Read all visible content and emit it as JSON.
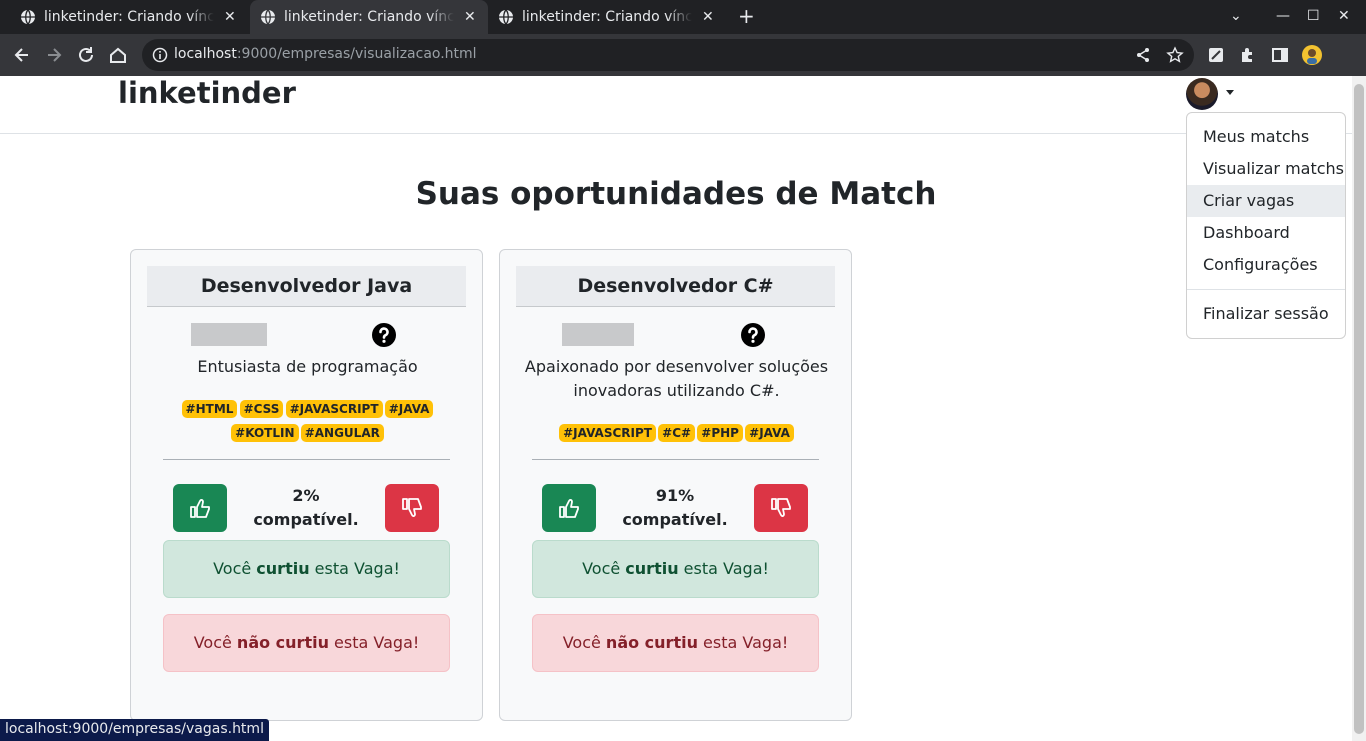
{
  "browser": {
    "tabs": [
      {
        "title": "linketinder: Criando vínculos",
        "active": false
      },
      {
        "title": "linketinder: Criando vínculos",
        "active": true
      },
      {
        "title": "linketinder: Criando vínculos",
        "active": false
      }
    ],
    "url_host": "localhost",
    "url_path": ":9000/empresas/visualizacao.html",
    "status_url": "localhost:9000/empresas/vagas.html"
  },
  "header": {
    "brand": "linketinder",
    "menu": {
      "items": [
        "Meus matchs",
        "Visualizar matchs",
        "Criar vagas",
        "Dashboard",
        "Configurações"
      ],
      "logout": "Finalizar sessão"
    }
  },
  "main": {
    "title": "Suas oportunidades de Match",
    "cards": [
      {
        "title": "Desenvolvedor Java",
        "description": "Entusiasta de programação",
        "tags": [
          "#HTML",
          "#CSS",
          "#JAVASCRIPT",
          "#JAVA",
          "#KOTLIN",
          "#ANGULAR"
        ],
        "percent": "2%",
        "compat_label": "compatível.",
        "liked_prefix": "Você ",
        "liked_bold": "curtiu",
        "liked_suffix": " esta Vaga!",
        "disliked_prefix": "Você ",
        "disliked_bold": "não curtiu",
        "disliked_suffix": " esta Vaga!"
      },
      {
        "title": "Desenvolvedor C#",
        "description": "Apaixonado por desenvolver soluções inovadoras utilizando C#.",
        "tags": [
          "#JAVASCRIPT",
          "#C#",
          "#PHP",
          "#JAVA"
        ],
        "percent": "91%",
        "compat_label": "compatível.",
        "liked_prefix": "Você ",
        "liked_bold": "curtiu",
        "liked_suffix": " esta Vaga!",
        "disliked_prefix": "Você ",
        "disliked_bold": "não curtiu",
        "disliked_suffix": " esta Vaga!"
      }
    ]
  },
  "colors": {
    "like": "#198754",
    "dislike": "#dc3545",
    "tag": "#ffc107",
    "success_bg": "#d1e7dd",
    "danger_bg": "#f8d7da"
  },
  "icons": [
    "globe-icon",
    "close-icon",
    "plus-icon",
    "back-icon",
    "forward-icon",
    "reload-icon",
    "home-icon",
    "info-icon",
    "share-icon",
    "star-icon",
    "extension-icon",
    "sidebar-icon",
    "profile-icon",
    "question-circle-icon",
    "thumbs-up-icon",
    "thumbs-down-icon"
  ]
}
